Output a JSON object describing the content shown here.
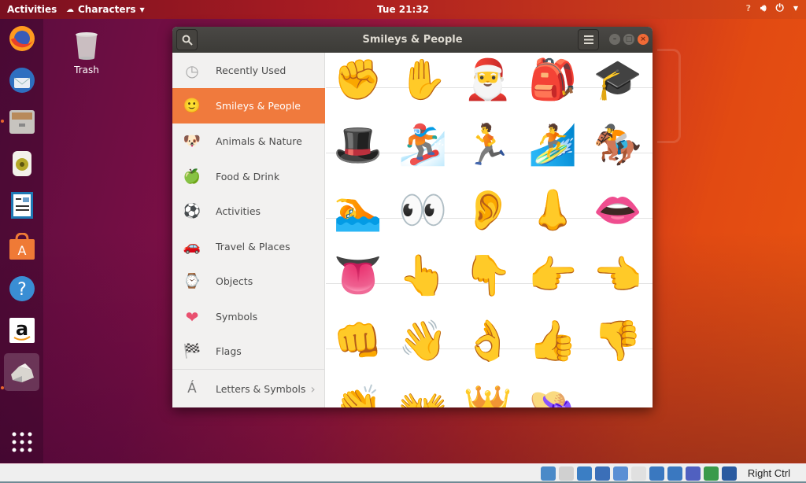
{
  "topbar": {
    "activities": "Activities",
    "app_menu": "Characters",
    "clock": "Tue 21:32",
    "tray_icons": [
      "accessibility-icon",
      "volume-icon",
      "power-icon",
      "menu-arrow-icon"
    ]
  },
  "dock": {
    "items": [
      {
        "name": "firefox",
        "running": false
      },
      {
        "name": "thunderbird",
        "running": false
      },
      {
        "name": "files",
        "running": true
      },
      {
        "name": "rhythmbox",
        "running": false
      },
      {
        "name": "libreoffice-writer",
        "running": false
      },
      {
        "name": "ubuntu-software",
        "running": false
      },
      {
        "name": "help",
        "running": false
      },
      {
        "name": "amazon",
        "running": false
      },
      {
        "name": "characters",
        "running": true,
        "active": true
      }
    ],
    "show_apps": "show-applications"
  },
  "desktop": {
    "trash_label": "Trash"
  },
  "window": {
    "title": "Smileys & People",
    "search_icon": "search-icon",
    "menu_icon": "hamburger-menu-icon",
    "controls": [
      "minimize",
      "maximize",
      "close"
    ]
  },
  "sidebar": {
    "items": [
      {
        "label": "Recently Used",
        "icon": "🕒",
        "selected": false
      },
      {
        "label": "Smileys & People",
        "icon": "🙂",
        "selected": true
      },
      {
        "label": "Animals & Nature",
        "icon": "🐶",
        "selected": false
      },
      {
        "label": "Food & Drink",
        "icon": "🍏",
        "selected": false
      },
      {
        "label": "Activities",
        "icon": "⚽",
        "selected": false
      },
      {
        "label": "Travel & Places",
        "icon": "🚗",
        "selected": false
      },
      {
        "label": "Objects",
        "icon": "⌚",
        "selected": false
      },
      {
        "label": "Symbols",
        "icon": "❤",
        "selected": false
      },
      {
        "label": "Flags",
        "icon": "🏁",
        "selected": false
      }
    ],
    "letters": {
      "label": "Letters & Symbols",
      "icon": "Á",
      "chevron": "›"
    }
  },
  "emoji_grid": {
    "rows": [
      [
        "✊",
        "✋",
        "🎅",
        "🎒",
        "🎓"
      ],
      [
        "🎩",
        "🏂",
        "🏃",
        "🏄",
        "🏇"
      ],
      [
        "🏊",
        "👀",
        "👂",
        "👃",
        "👄"
      ],
      [
        "👅",
        "👆",
        "👇",
        "👉",
        "👈"
      ],
      [
        "👊",
        "👋",
        "👌",
        "👍",
        "👎"
      ],
      [
        "👏",
        "👐",
        "👑",
        "👒",
        ""
      ]
    ]
  },
  "statusbar": {
    "host_key": "Right Ctrl",
    "icons": [
      "hard-disk",
      "optical-drive",
      "audio",
      "network",
      "usb",
      "shared-folders",
      "display",
      "screen-capture",
      "cpu",
      "guest-additions",
      "download"
    ]
  }
}
